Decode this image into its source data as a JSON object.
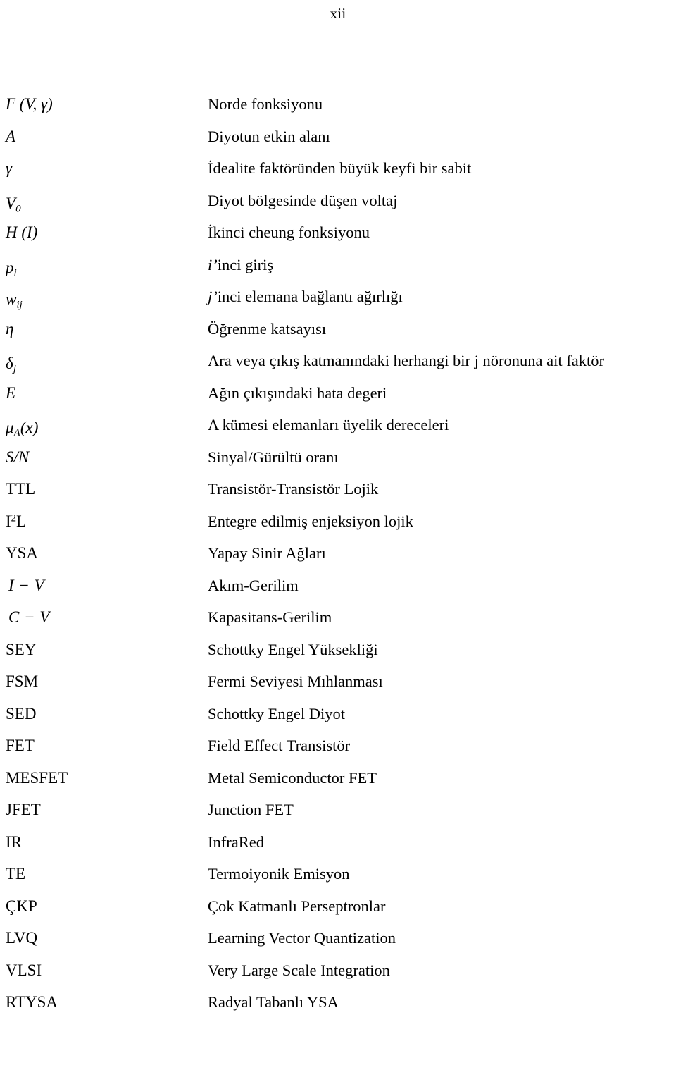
{
  "page": {
    "number": "xii"
  },
  "glossary": {
    "entries": [
      {
        "symbol": "F (V, γ)",
        "symbol_kind": "math",
        "description": "Norde fonksiyonu"
      },
      {
        "symbol": "A",
        "symbol_kind": "math",
        "description": "Diyotun etkin alanı"
      },
      {
        "symbol": "γ",
        "symbol_kind": "math",
        "description": "İdealite faktöründen büyük keyfi bir sabit"
      },
      {
        "symbol": "V",
        "symbol_sub": "0",
        "symbol_kind": "math",
        "description": "Diyot bölgesinde düşen voltaj"
      },
      {
        "symbol": "H (I)",
        "symbol_kind": "math",
        "description": "İkinci cheung fonksiyonu"
      },
      {
        "symbol": "p",
        "symbol_sub": "i",
        "symbol_kind": "math",
        "description_lead": "i’",
        "description": "inci giriş"
      },
      {
        "symbol": "w",
        "symbol_sub": "ij",
        "symbol_kind": "math",
        "description_lead": "j’",
        "description": "inci elemana bağlantı ağırlığı"
      },
      {
        "symbol": "η",
        "symbol_kind": "math",
        "description": "Öğrenme katsayısı"
      },
      {
        "symbol": "δ",
        "symbol_sub": "j",
        "symbol_kind": "math",
        "description": "Ara veya çıkış katmanındaki herhangi bir j nöronuna ait faktör"
      },
      {
        "symbol": "E",
        "symbol_kind": "math",
        "description": "Ağın çıkışındaki hata degeri"
      },
      {
        "symbol": "μ",
        "symbol_sub": "A",
        "symbol_tail": "(x)",
        "symbol_kind": "math",
        "description": "A kümesi elemanları üyelik dereceleri"
      },
      {
        "symbol": "S/N",
        "symbol_kind": "math",
        "description": "Sinyal/Gürültü oranı"
      },
      {
        "symbol": "TTL",
        "symbol_kind": "roman",
        "description": "Transistör-Transistör Lojik"
      },
      {
        "symbol": "I",
        "symbol_sup": "2",
        "symbol_tail": "L",
        "symbol_kind": "roman",
        "description": "Entegre edilmiş enjeksiyon lojik"
      },
      {
        "symbol": "YSA",
        "symbol_kind": "roman",
        "description": "Yapay Sinir Ağları"
      },
      {
        "symbol": "I − V",
        "symbol_kind": "mathspace",
        "description": "Akım-Gerilim"
      },
      {
        "symbol": "C − V",
        "symbol_kind": "mathspace",
        "description": "Kapasitans-Gerilim"
      },
      {
        "symbol": "SEY",
        "symbol_kind": "roman",
        "description": "Schottky Engel Yüksekliği"
      },
      {
        "symbol": "FSM",
        "symbol_kind": "roman",
        "description": "Fermi Seviyesi Mıhlanması"
      },
      {
        "symbol": "SED",
        "symbol_kind": "roman",
        "description": "Schottky Engel Diyot"
      },
      {
        "symbol": "FET",
        "symbol_kind": "roman",
        "description": "Field Effect Transistör"
      },
      {
        "symbol": "MESFET",
        "symbol_kind": "roman",
        "description": "Metal Semiconductor FET"
      },
      {
        "symbol": "JFET",
        "symbol_kind": "roman",
        "description": "Junction FET"
      },
      {
        "symbol": "IR",
        "symbol_kind": "roman",
        "description": "InfraRed"
      },
      {
        "symbol": "TE",
        "symbol_kind": "roman",
        "description": "Termoiyonik Emisyon"
      },
      {
        "symbol": "ÇKP",
        "symbol_kind": "roman",
        "description": "Çok Katmanlı Perseptronlar"
      },
      {
        "symbol": "LVQ",
        "symbol_kind": "roman",
        "description": "Learning Vector Quantization"
      },
      {
        "symbol": "VLSI",
        "symbol_kind": "roman",
        "description": "Very Large Scale Integration"
      },
      {
        "symbol": "RTYSA",
        "symbol_kind": "roman",
        "description": "Radyal Tabanlı YSA"
      }
    ]
  }
}
